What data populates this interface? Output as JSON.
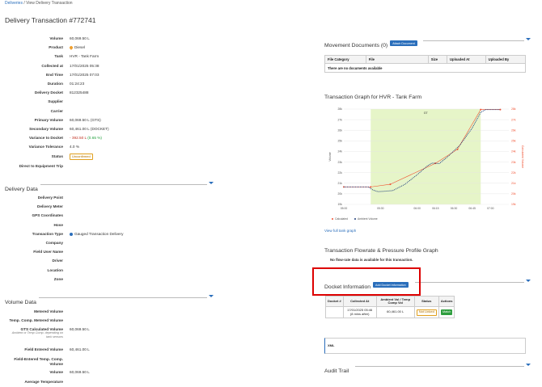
{
  "breadcrumb": {
    "root": "Deliveries",
    "sep": "/",
    "current": "View Delivery Transaction"
  },
  "page_title": "Delivery Transaction #772741",
  "details": [
    {
      "label": "Volume",
      "value": "60,069.50 L"
    },
    {
      "label": "Product",
      "value": "Diesel"
    },
    {
      "label": "Tank",
      "value": "HVR - Tank Farm"
    },
    {
      "label": "Collected at",
      "value": "17/01/2025 05:38"
    },
    {
      "label": "End Time",
      "value": "17/01/2025 07:03"
    },
    {
      "label": "Duration",
      "value": "01:24:23"
    },
    {
      "label": "Delivery Docket",
      "value": "812325488"
    },
    {
      "label": "Supplier",
      "value": ""
    },
    {
      "label": "Carrier",
      "value": ""
    },
    {
      "label": "Primary Volume",
      "value": "60,069.50 L (GTS)"
    },
    {
      "label": "Secondary Volume",
      "value": "60,461.00 L (DOCKET)"
    },
    {
      "label": "Variance to Docket",
      "value": "- 392.50 L",
      "extra": "(0.65 %)"
    },
    {
      "label": "Variance Tolerance",
      "value": "4.0 %"
    },
    {
      "label": "Status",
      "value": "Unconfirmed"
    },
    {
      "label": "Direct to Equipment Trip",
      "value": ""
    }
  ],
  "delivery_data": {
    "heading": "Delivery Data",
    "rows": [
      {
        "label": "Delivery Point",
        "value": ""
      },
      {
        "label": "Delivery Meter",
        "value": ""
      },
      {
        "label": "GPS Coordinates",
        "value": ""
      },
      {
        "label": "Hose",
        "value": ""
      },
      {
        "label": "Transaction Type",
        "value": "Gauged Transaction Delivery"
      },
      {
        "label": "Company",
        "value": ""
      },
      {
        "label": "Field User Name",
        "value": ""
      },
      {
        "label": "Driver",
        "value": ""
      },
      {
        "label": "Location",
        "value": ""
      },
      {
        "label": "Zone",
        "value": ""
      }
    ]
  },
  "volume_data": {
    "heading": "Volume Data",
    "rows": [
      {
        "label": "Metered Volume",
        "value": ""
      },
      {
        "label": "Temp. Comp. Metered Volume",
        "value": ""
      },
      {
        "label": "GTS Calculated Volume",
        "value": "60,069.50 L",
        "sub": "Ambient or Temp Comp. depending on tank sensors"
      },
      {
        "label": "Field Entered Volume",
        "value": "60,461.00 L"
      },
      {
        "label": "Field-Entered Temp. Comp. Volume",
        "value": ""
      },
      {
        "label": "Volume",
        "value": "60,069.50 L"
      },
      {
        "label": "Average Temperature",
        "value": ""
      }
    ]
  },
  "movement_docs": {
    "heading": "Movement Documents (0)",
    "button": "Attach Document",
    "columns": [
      "File Category",
      "File",
      "Size",
      "Uploaded At",
      "Uploaded By"
    ],
    "empty": "There are no documents available"
  },
  "graph": {
    "heading": "Transaction Graph for HVR - Tank Farm",
    "view_link": "View full tank graph"
  },
  "chart_data": {
    "type": "line",
    "title": "",
    "region_label": "GT",
    "x": [
      "05:00",
      "05:30",
      "06:00",
      "06:15",
      "06:30",
      "06:45",
      "07:00"
    ],
    "xlabel": "",
    "ylabel": "Volume",
    "y2label": "Calculated Volume",
    "y_ticks": [
      "19k",
      "20k",
      "21k",
      "22k",
      "23k",
      "24k",
      "25k",
      "26k",
      "27k",
      "28k"
    ],
    "y2_ticks": [
      "19k",
      "20k",
      "21k",
      "22k",
      "23k",
      "24k",
      "25k",
      "26k",
      "27k",
      "28k"
    ],
    "ylim": [
      19000,
      28000
    ],
    "xlim_minutes_from_0500": [
      0,
      135
    ],
    "shaded_region_minutes": [
      22,
      112
    ],
    "series": [
      {
        "name": "Calculated",
        "color": "#f05030",
        "style": "line-markers",
        "points": [
          [
            0,
            20650
          ],
          [
            22,
            20650
          ],
          [
            38,
            20900
          ],
          [
            75,
            22880
          ],
          [
            93,
            24200
          ],
          [
            112,
            27950
          ],
          [
            128,
            27950
          ]
        ]
      },
      {
        "name": "Ambient Volume",
        "color": "#1f3e7a",
        "style": "dotted",
        "points": [
          [
            0,
            20650
          ],
          [
            20,
            20650
          ],
          [
            24,
            20350
          ],
          [
            28,
            20200
          ],
          [
            40,
            20300
          ],
          [
            50,
            20900
          ],
          [
            60,
            21800
          ],
          [
            68,
            22600
          ],
          [
            72,
            22900
          ],
          [
            78,
            22850
          ],
          [
            85,
            23500
          ],
          [
            95,
            24600
          ],
          [
            105,
            26200
          ],
          [
            112,
            27700
          ],
          [
            116,
            27950
          ],
          [
            128,
            27950
          ]
        ]
      }
    ],
    "legend": [
      "Calculated",
      "Ambient Volume"
    ],
    "legend_position": "bottom-left",
    "colors": {
      "region": "#e6f5c8",
      "calculated": "#f05030",
      "ambient": "#1f3e7a"
    }
  },
  "flowrate": {
    "heading": "Transaction Flowrate & Pressure Profile Graph",
    "message": "No flow-rate data is available for this transaction."
  },
  "docket": {
    "heading": "Docket Information",
    "button": "Add Docket Information",
    "columns": [
      "Docket #",
      "Collected At",
      "Ambient Vol / Temp Comp Vol",
      "Status",
      "Actions"
    ],
    "row": {
      "docket": "",
      "collected": "17/01/2025 05:46",
      "collected_sub": "(8 mins after)",
      "vol": "60,461.00 L",
      "status": "Not Linked",
      "action": "Match"
    }
  },
  "xml": {
    "label": "XML"
  },
  "audit": {
    "heading": "Audit Trail"
  }
}
